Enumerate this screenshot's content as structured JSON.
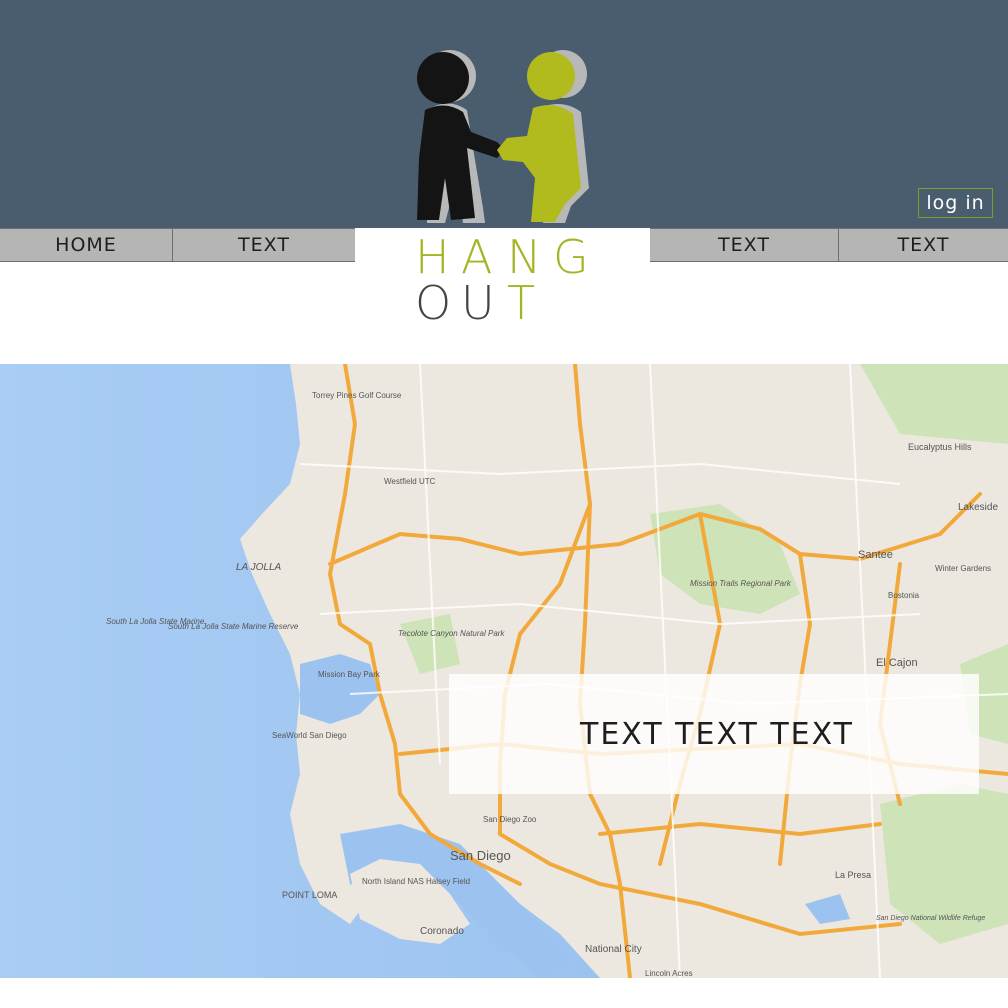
{
  "header": {
    "login_label": "log in",
    "colors": {
      "band": "#495d6e",
      "accent": "#a5b325",
      "dark": "#1a1a1a"
    }
  },
  "nav": {
    "items": [
      {
        "label": "HOME"
      },
      {
        "label": "TEXT"
      },
      {
        "label": "TEXT"
      },
      {
        "label": "TEXT"
      }
    ]
  },
  "wordmark": {
    "row1": [
      "H",
      "A",
      "N",
      "G"
    ],
    "row2": [
      "O",
      "U",
      "T"
    ]
  },
  "map": {
    "overlay_text": "TEXT TEXT TEXT",
    "labels": {
      "san_diego": "San Diego",
      "la_jolla": "LA JOLLA",
      "santee": "Santee",
      "el_cajon": "El Cajon",
      "lakeside": "Lakeside",
      "eucalyptus_hills": "Eucalyptus Hills",
      "national_city": "National City",
      "coronado": "Coronado",
      "point_loma": "POINT LOMA",
      "mission_trails": "Mission Trails Regional Park",
      "la_presa": "La Presa",
      "torrey_pines": "Torrey Pines Golf Course",
      "westfield_utc": "Westfield UTC",
      "tecolote": "Tecolote Canyon Natural Park",
      "mission_bay_park": "Mission Bay Park",
      "seaworld": "SeaWorld San Diego",
      "san_diego_zoo": "San Diego Zoo",
      "north_island": "North Island NAS Halsey Field",
      "marine_reserve": "South La Jolla State Marine Reserve",
      "marine_reserve2": "South La Jolla State Marine",
      "winter_gardens": "Winter Gardens",
      "bostonia": "Bostonia",
      "lincoln_acres": "Lincoln Acres",
      "sd_wildlife": "San Diego National Wildlife Refuge"
    }
  }
}
